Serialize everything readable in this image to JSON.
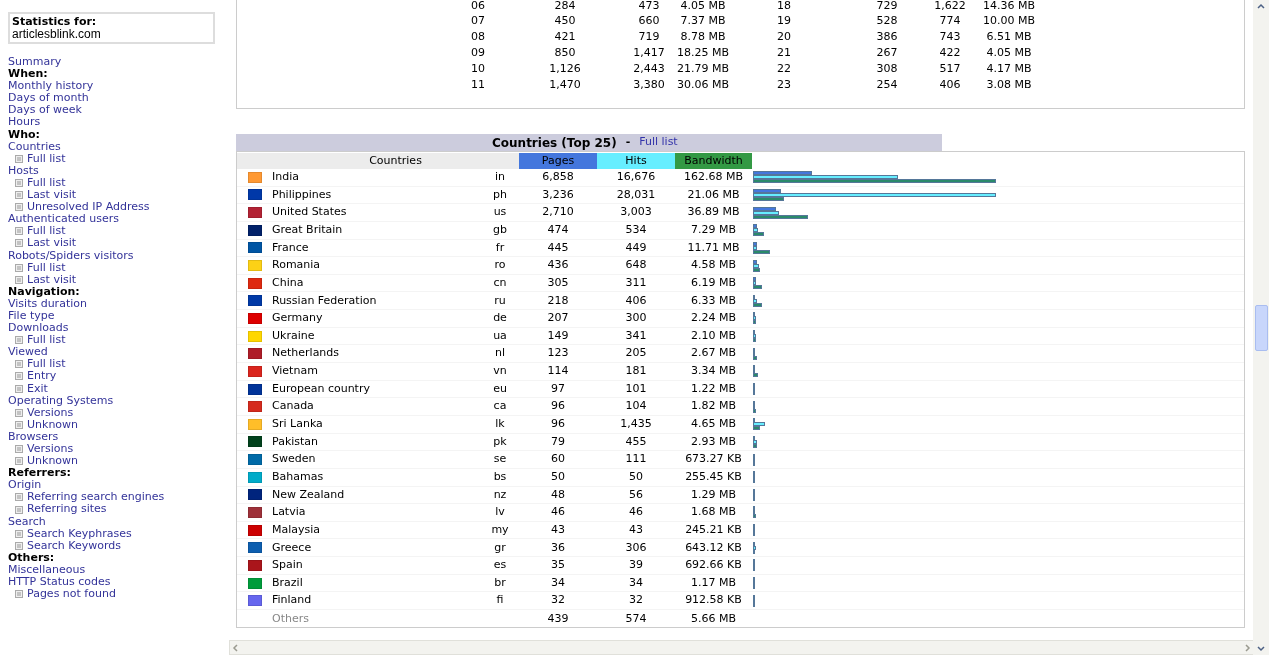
{
  "stats_box": {
    "label": "Statistics for:",
    "site": "articlesblink.com"
  },
  "sidebar": {
    "items": [
      {
        "kind": "link",
        "label": "Summary"
      },
      {
        "kind": "heading",
        "label": "When:"
      },
      {
        "kind": "link",
        "label": "Monthly history"
      },
      {
        "kind": "link",
        "label": "Days of month"
      },
      {
        "kind": "link",
        "label": "Days of week"
      },
      {
        "kind": "link",
        "label": "Hours"
      },
      {
        "kind": "heading",
        "label": "Who:"
      },
      {
        "kind": "link",
        "label": "Countries",
        "children": [
          {
            "label": "Full list"
          }
        ]
      },
      {
        "kind": "link",
        "label": "Hosts",
        "children": [
          {
            "label": "Full list"
          },
          {
            "label": "Last visit"
          },
          {
            "label": "Unresolved IP Address"
          }
        ]
      },
      {
        "kind": "link",
        "label": "Authenticated users",
        "children": [
          {
            "label": "Full list"
          },
          {
            "label": "Last visit"
          }
        ]
      },
      {
        "kind": "link",
        "label": "Robots/Spiders visitors",
        "children": [
          {
            "label": "Full list"
          },
          {
            "label": "Last visit"
          }
        ]
      },
      {
        "kind": "heading",
        "label": "Navigation:"
      },
      {
        "kind": "link",
        "label": "Visits duration"
      },
      {
        "kind": "link",
        "label": "File type"
      },
      {
        "kind": "link",
        "label": "Downloads",
        "children": [
          {
            "label": "Full list"
          }
        ]
      },
      {
        "kind": "link",
        "label": "Viewed",
        "children": [
          {
            "label": "Full list"
          },
          {
            "label": "Entry"
          },
          {
            "label": "Exit"
          }
        ]
      },
      {
        "kind": "link",
        "label": "Operating Systems",
        "children": [
          {
            "label": "Versions"
          },
          {
            "label": "Unknown"
          }
        ]
      },
      {
        "kind": "link",
        "label": "Browsers",
        "children": [
          {
            "label": "Versions"
          },
          {
            "label": "Unknown"
          }
        ]
      },
      {
        "kind": "heading",
        "label": "Referrers:"
      },
      {
        "kind": "link",
        "label": "Origin",
        "children": [
          {
            "label": "Referring search engines"
          },
          {
            "label": "Referring sites"
          }
        ]
      },
      {
        "kind": "link",
        "label": "Search",
        "children": [
          {
            "label": "Search Keyphrases"
          },
          {
            "label": "Search Keywords"
          }
        ]
      },
      {
        "kind": "heading",
        "label": "Others:"
      },
      {
        "kind": "link",
        "label": "Miscellaneous"
      },
      {
        "kind": "link",
        "label": "HTTP Status codes",
        "children": [
          {
            "label": "Pages not found"
          }
        ]
      }
    ]
  },
  "hours_table": {
    "rows": [
      [
        "06",
        "284",
        "473",
        "4.05 MB",
        "18",
        "729",
        "1,622",
        "14.36 MB"
      ],
      [
        "07",
        "450",
        "660",
        "7.37 MB",
        "19",
        "528",
        "774",
        "10.00 MB"
      ],
      [
        "08",
        "421",
        "719",
        "8.78 MB",
        "20",
        "386",
        "743",
        "6.51 MB"
      ],
      [
        "09",
        "850",
        "1,417",
        "18.25 MB",
        "21",
        "267",
        "422",
        "4.05 MB"
      ],
      [
        "10",
        "1,126",
        "2,443",
        "21.79 MB",
        "22",
        "308",
        "517",
        "4.17 MB"
      ],
      [
        "11",
        "1,470",
        "3,380",
        "30.06 MB",
        "23",
        "254",
        "406",
        "3.08 MB"
      ]
    ]
  },
  "countries": {
    "title": "Countries (Top 25)",
    "separator": "-",
    "full_list_link": "Full list",
    "columns": [
      "Countries",
      "Pages",
      "Hits",
      "Bandwidth"
    ],
    "rows": [
      {
        "name": "India",
        "code": "in",
        "pages": "6,858",
        "hits": "16,676",
        "bandwidth": "162.68 MB",
        "color": "#ff9933"
      },
      {
        "name": "Philippines",
        "code": "ph",
        "pages": "3,236",
        "hits": "28,031",
        "bandwidth": "21.06 MB",
        "color": "#0038a8"
      },
      {
        "name": "United States",
        "code": "us",
        "pages": "2,710",
        "hits": "3,003",
        "bandwidth": "36.89 MB",
        "color": "#b22234"
      },
      {
        "name": "Great Britain",
        "code": "gb",
        "pages": "474",
        "hits": "534",
        "bandwidth": "7.29 MB",
        "color": "#012169"
      },
      {
        "name": "France",
        "code": "fr",
        "pages": "445",
        "hits": "449",
        "bandwidth": "11.71 MB",
        "color": "#0055a4"
      },
      {
        "name": "Romania",
        "code": "ro",
        "pages": "436",
        "hits": "648",
        "bandwidth": "4.58 MB",
        "color": "#fcd116"
      },
      {
        "name": "China",
        "code": "cn",
        "pages": "305",
        "hits": "311",
        "bandwidth": "6.19 MB",
        "color": "#de2910"
      },
      {
        "name": "Russian Federation",
        "code": "ru",
        "pages": "218",
        "hits": "406",
        "bandwidth": "6.33 MB",
        "color": "#0039a6"
      },
      {
        "name": "Germany",
        "code": "de",
        "pages": "207",
        "hits": "300",
        "bandwidth": "2.24 MB",
        "color": "#dd0000"
      },
      {
        "name": "Ukraine",
        "code": "ua",
        "pages": "149",
        "hits": "341",
        "bandwidth": "2.10 MB",
        "color": "#ffd700"
      },
      {
        "name": "Netherlands",
        "code": "nl",
        "pages": "123",
        "hits": "205",
        "bandwidth": "2.67 MB",
        "color": "#ae1c28"
      },
      {
        "name": "Vietnam",
        "code": "vn",
        "pages": "114",
        "hits": "181",
        "bandwidth": "3.34 MB",
        "color": "#da251d"
      },
      {
        "name": "European country",
        "code": "eu",
        "pages": "97",
        "hits": "101",
        "bandwidth": "1.22 MB",
        "color": "#003399"
      },
      {
        "name": "Canada",
        "code": "ca",
        "pages": "96",
        "hits": "104",
        "bandwidth": "1.82 MB",
        "color": "#d52b1e"
      },
      {
        "name": "Sri Lanka",
        "code": "lk",
        "pages": "96",
        "hits": "1,435",
        "bandwidth": "4.65 MB",
        "color": "#ffbe29"
      },
      {
        "name": "Pakistan",
        "code": "pk",
        "pages": "79",
        "hits": "455",
        "bandwidth": "2.93 MB",
        "color": "#01411c"
      },
      {
        "name": "Sweden",
        "code": "se",
        "pages": "60",
        "hits": "111",
        "bandwidth": "673.27 KB",
        "color": "#006aa7"
      },
      {
        "name": "Bahamas",
        "code": "bs",
        "pages": "50",
        "hits": "50",
        "bandwidth": "255.45 KB",
        "color": "#00abc9"
      },
      {
        "name": "New Zealand",
        "code": "nz",
        "pages": "48",
        "hits": "56",
        "bandwidth": "1.29 MB",
        "color": "#00247d"
      },
      {
        "name": "Latvia",
        "code": "lv",
        "pages": "46",
        "hits": "46",
        "bandwidth": "1.68 MB",
        "color": "#9e3039"
      },
      {
        "name": "Malaysia",
        "code": "my",
        "pages": "43",
        "hits": "43",
        "bandwidth": "245.21 KB",
        "color": "#cc0001"
      },
      {
        "name": "Greece",
        "code": "gr",
        "pages": "36",
        "hits": "306",
        "bandwidth": "643.12 KB",
        "color": "#0d5eaf"
      },
      {
        "name": "Spain",
        "code": "es",
        "pages": "35",
        "hits": "39",
        "bandwidth": "692.66 KB",
        "color": "#aa151b"
      },
      {
        "name": "Brazil",
        "code": "br",
        "pages": "34",
        "hits": "34",
        "bandwidth": "1.17 MB",
        "color": "#009c3b"
      },
      {
        "name": "Finland",
        "code": "fi",
        "pages": "32",
        "hits": "32",
        "bandwidth": "912.58 KB",
        "color": "#6666ee"
      }
    ],
    "others": {
      "label": "Others",
      "pages": "439",
      "hits": "574",
      "bandwidth": "5.66 MB"
    }
  }
}
